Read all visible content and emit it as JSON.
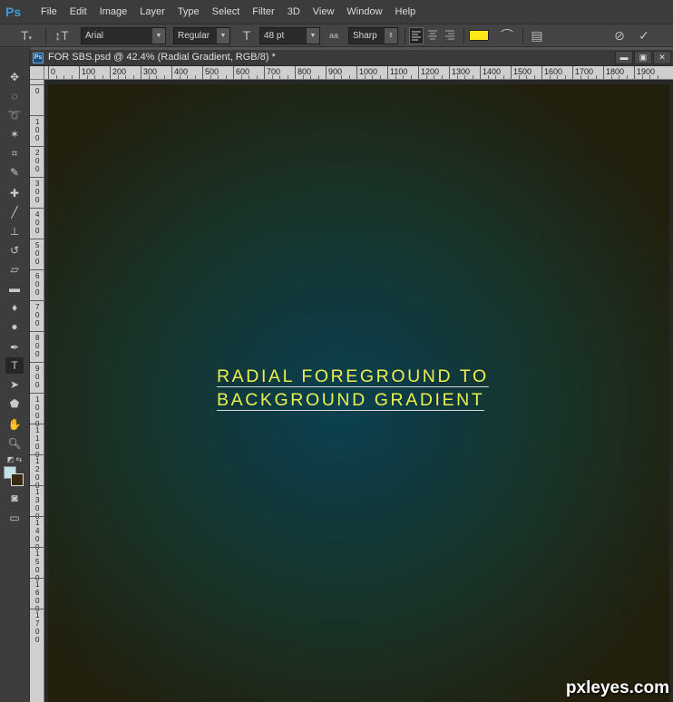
{
  "app": {
    "logo": "Ps"
  },
  "menu": [
    "File",
    "Edit",
    "Image",
    "Layer",
    "Type",
    "Select",
    "Filter",
    "3D",
    "View",
    "Window",
    "Help"
  ],
  "options": {
    "font_family": "Arial",
    "font_style": "Regular",
    "font_size": "48 pt",
    "aa_label": "aa",
    "antialias": "Sharp",
    "text_color": "#ffe81a"
  },
  "document": {
    "tab_title": "FOR SBS.psd @ 42.4% (Radial Gradient, RGB/8) *",
    "icon_label": "Ps"
  },
  "rulers": {
    "horizontal": [
      "0",
      "100",
      "200",
      "300",
      "400",
      "500",
      "600",
      "700",
      "800",
      "900",
      "1000",
      "1100",
      "1200",
      "1300",
      "1400",
      "1500",
      "1600",
      "1700",
      "1800",
      "1900"
    ],
    "vertical": [
      "0",
      "100",
      "200",
      "300",
      "400",
      "500",
      "600",
      "700",
      "800",
      "900",
      "1000",
      "1100",
      "1200",
      "1300",
      "1400",
      "1500",
      "1600",
      "1700"
    ]
  },
  "canvas": {
    "text_line1": "RADIAL FOREGROUND TO",
    "text_line2": "BACKGROUND GRADIENT",
    "text_color": "#ecf04f"
  },
  "colors": {
    "foreground": "#bfe3e8",
    "background": "#3a2a10"
  },
  "watermark": "pxleyes.com"
}
